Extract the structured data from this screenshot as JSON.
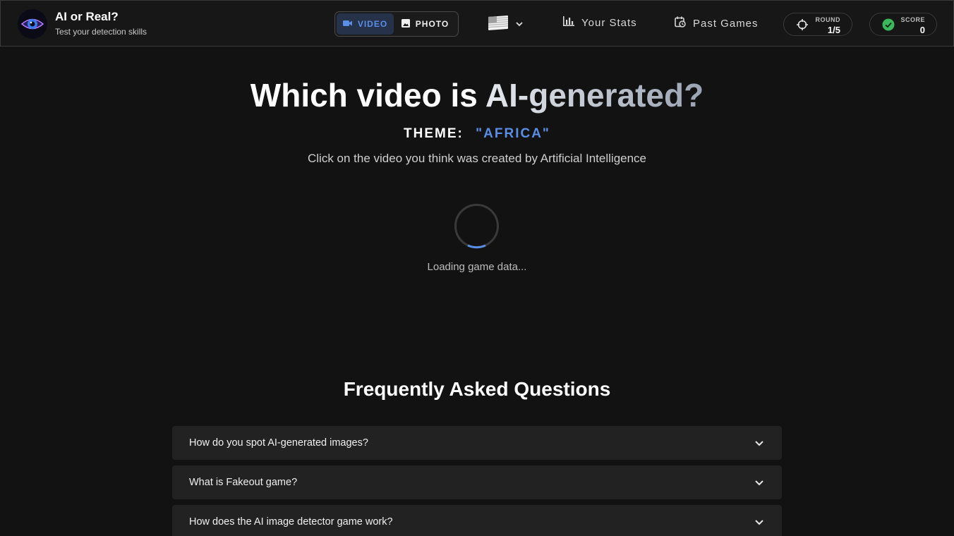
{
  "header": {
    "app_title": "AI or Real?",
    "app_subtitle": "Test your detection skills",
    "mode_toggle": {
      "video_label": "VIDEO",
      "photo_label": "PHOTO",
      "active": "video"
    },
    "language": {
      "icon": "us-flag-icon"
    },
    "nav": {
      "stats_label": "Your Stats",
      "past_games_label": "Past Games"
    },
    "round": {
      "label": "ROUND",
      "value": "1/5"
    },
    "score": {
      "label": "SCORE",
      "value": "0"
    }
  },
  "main": {
    "title_part1": "Which video is ",
    "title_part2": "AI-generated?",
    "theme_label": "THEME:",
    "theme_value": "\"AFRICA\"",
    "instruction": "Click on the video you think was created by Artificial Intelligence",
    "loading_text": "Loading game data..."
  },
  "faq": {
    "title": "Frequently Asked Questions",
    "items": [
      {
        "question": "How do you spot AI-generated images?"
      },
      {
        "question": "What is Fakeout game?"
      },
      {
        "question": "How does the AI image detector game work?"
      }
    ]
  },
  "colors": {
    "accent": "#5a8de6",
    "background": "#121212",
    "header_bg": "#171717",
    "score_check": "#3cb85c"
  }
}
